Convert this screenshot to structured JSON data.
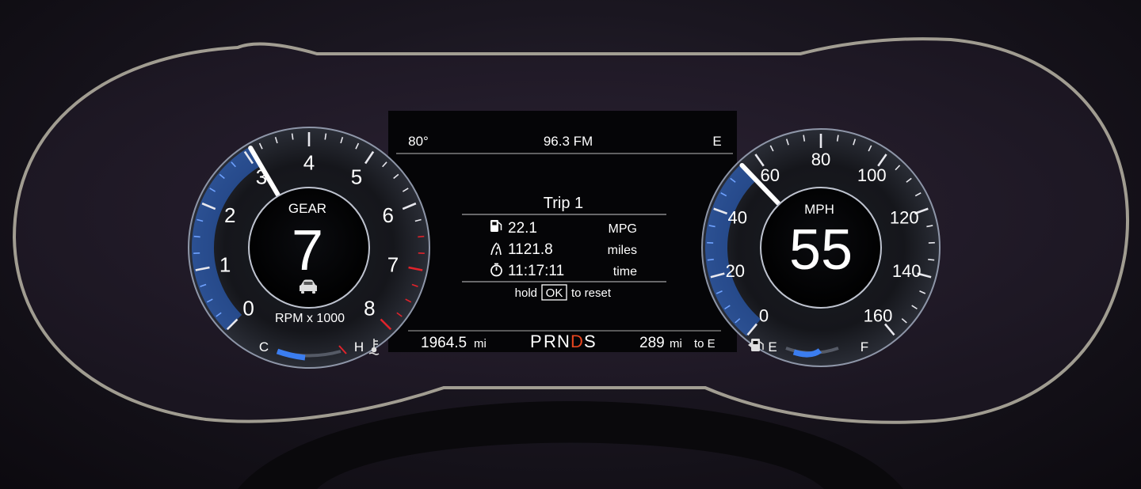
{
  "top_bar": {
    "temperature": "80°",
    "radio": "96.3 FM",
    "compass": "E"
  },
  "tachometer": {
    "gear_label": "GEAR",
    "gear_value": "7",
    "unit_label": "RPM x 1000",
    "scale_labels": [
      "0",
      "1",
      "2",
      "3",
      "4",
      "5",
      "6",
      "7",
      "8"
    ],
    "rpm_value": 3.1,
    "redline_from": 6.5,
    "max": 8,
    "icon": "car-icon"
  },
  "speedometer": {
    "unit_label": "MPH",
    "speed_value": "55",
    "speed": 55,
    "scale_labels": [
      "0",
      "20",
      "40",
      "60",
      "80",
      "100",
      "120",
      "140",
      "160"
    ],
    "max": 160
  },
  "trip": {
    "title": "Trip 1",
    "rows": [
      {
        "icon": "fuel-pump-icon",
        "value": "22.1",
        "unit": "MPG"
      },
      {
        "icon": "road-icon",
        "value": "1121.8",
        "unit": "miles"
      },
      {
        "icon": "stopwatch-icon",
        "value": "11:17:11",
        "unit": "time"
      }
    ],
    "reset_hint_prefix": "hold",
    "reset_hint_key": "OK",
    "reset_hint_suffix": "to reset"
  },
  "bottom_bar": {
    "odometer_value": "1964.5",
    "odometer_unit": "mi",
    "gear_selector": [
      "P",
      "R",
      "N",
      "D",
      "S"
    ],
    "active_gear_index": 3,
    "range_value": "289",
    "range_unit": "mi",
    "range_suffix": "to E"
  },
  "temp_gauge": {
    "cold_label": "C",
    "hot_label": "H",
    "level": 0.5,
    "icon": "coolant-temp-icon"
  },
  "fuel_gauge": {
    "empty_label": "E",
    "full_label": "F",
    "level": 0.65,
    "icon": "fuel-pump-icon"
  },
  "colors": {
    "accent_blue": "#2f6fe0",
    "active_gear": "#e8461f",
    "redline": "#e0232b",
    "needle": "#ffffff"
  }
}
